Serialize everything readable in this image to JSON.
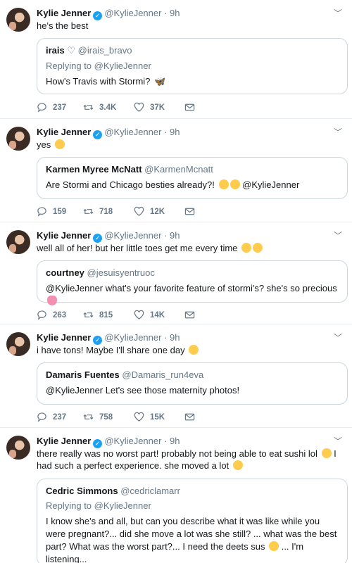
{
  "tweets": [
    {
      "name": "Kylie Jenner",
      "handle_time": "@KylieJenner · 9h",
      "text": "he's the best",
      "quote": {
        "name": "irais",
        "name_symbol": "♡",
        "handle": "@irais_bravo",
        "replying": "Replying to @KylieJenner",
        "text": "How's Travis with Stormi?"
      },
      "replies": "237",
      "retweets": "3.4K",
      "likes": "37K"
    },
    {
      "name": "Kylie Jenner",
      "handle_time": "@KylieJenner · 9h",
      "text": "yes",
      "quote": {
        "name": "Karmen Myree McNatt",
        "handle": "@KarmenMcnatt",
        "text": "Are Stormi and Chicago besties already?!",
        "text_after": "@KylieJenner"
      },
      "replies": "159",
      "retweets": "718",
      "likes": "12K"
    },
    {
      "name": "Kylie Jenner",
      "handle_time": "@KylieJenner · 9h",
      "text": "well all of her! but her little toes get me every time",
      "quote": {
        "name": "courtney",
        "handle": "@jesuisyentruoc",
        "text": "@KylieJenner what's your favorite feature of stormi's? she's so precious"
      },
      "replies": "263",
      "retweets": "815",
      "likes": "14K"
    },
    {
      "name": "Kylie Jenner",
      "handle_time": "@KylieJenner · 9h",
      "text": "i have tons! Maybe I'll share one day",
      "quote": {
        "name": "Damaris Fuentes",
        "handle": "@Damaris_run4eva",
        "text": "@KylieJenner Let's see those maternity photos!"
      },
      "replies": "237",
      "retweets": "758",
      "likes": "15K"
    },
    {
      "name": "Kylie Jenner",
      "handle_time": "@KylieJenner · 9h",
      "text": "there really was no worst part! probably not being able to eat sushi lol",
      "text_2": "I had such a perfect experience. she moved a lot",
      "quote": {
        "name": "Cedric Simmons",
        "handle": "@cedriclamarr",
        "replying": "Replying to @KylieJenner",
        "text": "I know she's and all, but can you describe what it was like while you were pregnant?... did she move a lot was she still? ... what was the best part? What was the worst part?... I need the deets sus",
        "text_after": "... I'm listening..."
      }
    }
  ],
  "icons": {
    "reply": "reply-icon",
    "retweet": "retweet-icon",
    "like": "heart-icon",
    "message": "envelope-icon",
    "caret": "chevron-down-icon",
    "verified": "verified-badge-icon"
  },
  "colors": {
    "verified": "#1da1f2",
    "secondary_text": "#657786",
    "border": "#ccd6dd"
  }
}
